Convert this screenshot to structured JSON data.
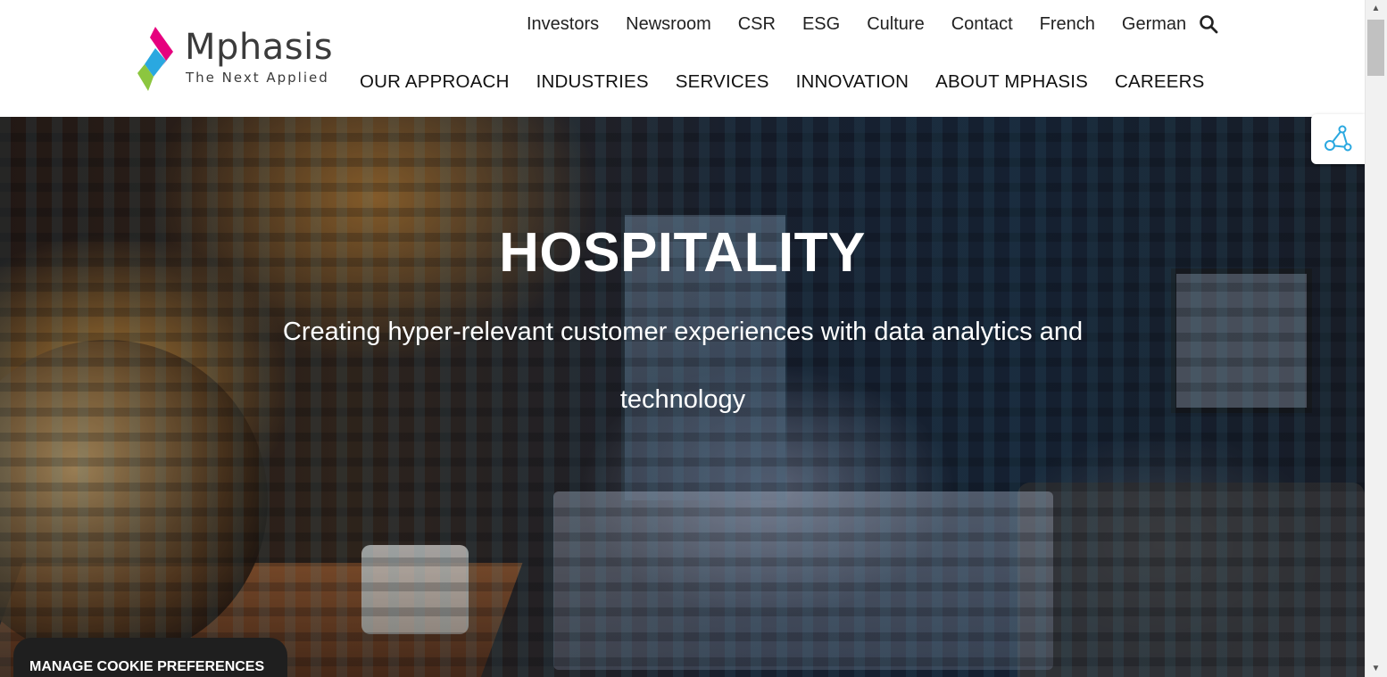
{
  "brand": {
    "name": "Mphasis",
    "tagline": "The Next Applied",
    "colors": {
      "magenta": "#e6007e",
      "blue": "#2aa8e0",
      "green": "#8cc63f",
      "text": "#3b3b3b"
    }
  },
  "utility_nav": {
    "items": [
      "Investors",
      "Newsroom",
      "CSR",
      "ESG",
      "Culture",
      "Contact",
      "French",
      "German"
    ],
    "search_icon": "search-icon"
  },
  "main_nav": {
    "items": [
      "OUR APPROACH",
      "INDUSTRIES",
      "SERVICES",
      "INNOVATION",
      "ABOUT MPHASIS",
      "CAREERS"
    ]
  },
  "hero": {
    "title": "HOSPITALITY",
    "subtitle": "Creating hyper-relevant customer experiences with data analytics and technology"
  },
  "float_widget": {
    "icon": "share-nodes-icon",
    "accent": "#2aa8e0"
  },
  "cookie": {
    "label": "MANAGE COOKIE PREFERENCES"
  },
  "scrollbar": {
    "up_icon": "scroll-up-arrow",
    "down_icon": "scroll-down-arrow"
  }
}
